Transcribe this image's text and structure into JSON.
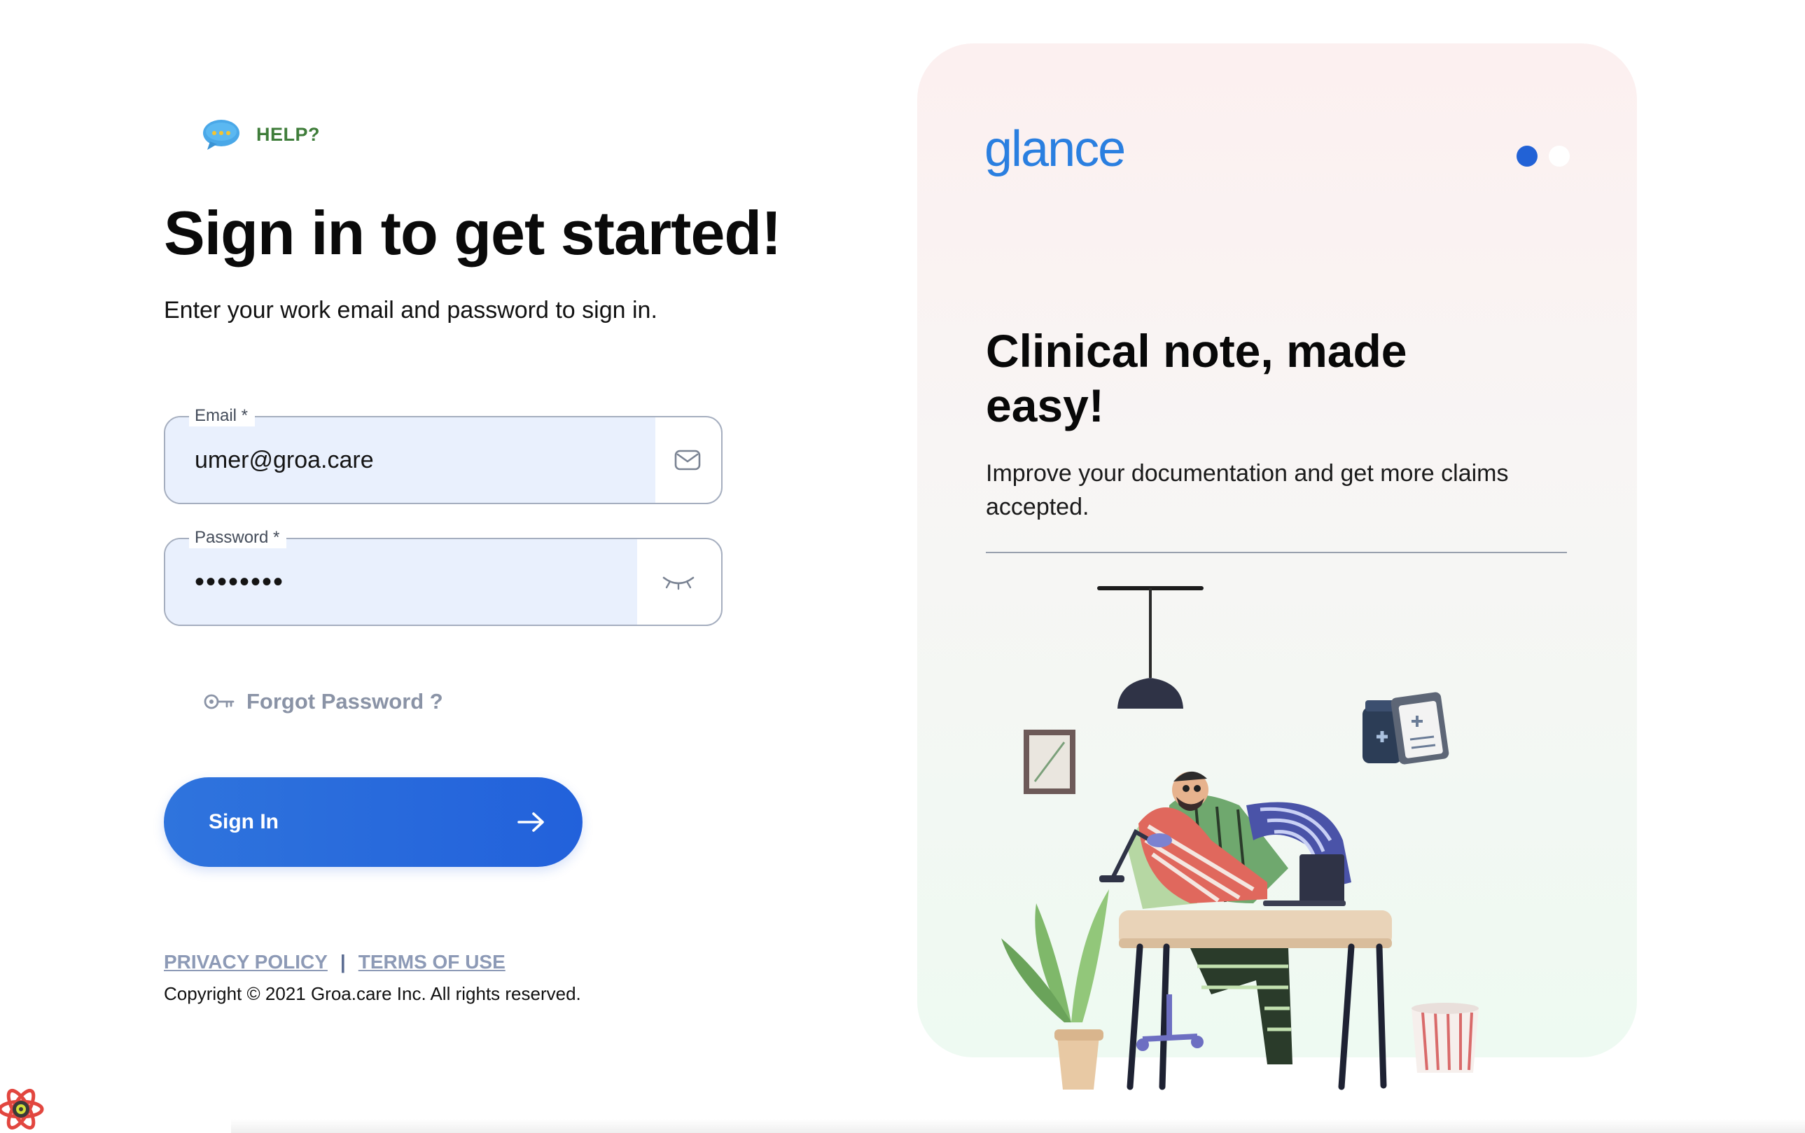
{
  "help": {
    "label": "HELP?",
    "icon": "chat-bubble-icon"
  },
  "heading": "Sign in to get started!",
  "subheading": "Enter your work email and password to sign in.",
  "email": {
    "label": "Email *",
    "value": "umer@groa.care",
    "icon": "envelope-icon"
  },
  "password": {
    "label": "Password *",
    "value": "••••••••",
    "icon": "eye-closed-icon"
  },
  "forgot": {
    "label": "Forgot Password ?",
    "icon": "key-icon"
  },
  "signin": {
    "label": "Sign In",
    "icon": "arrow-right-icon"
  },
  "legal": {
    "privacy": "PRIVACY POLICY",
    "separator": "|",
    "terms": "TERMS OF USE",
    "copyright": "Copyright © 2021 Groa.care Inc. All rights reserved."
  },
  "panel": {
    "logo": "glance",
    "heading": "Clinical note, made easy!",
    "description": "Improve your documentation and get more claims accepted.",
    "carousel": {
      "count": 2,
      "active": 1
    }
  },
  "colors": {
    "primary": "#2262d6",
    "help_green": "#3f7d3a",
    "input_fill": "#e9f0fd",
    "logo_blue": "#2a7fe0"
  }
}
